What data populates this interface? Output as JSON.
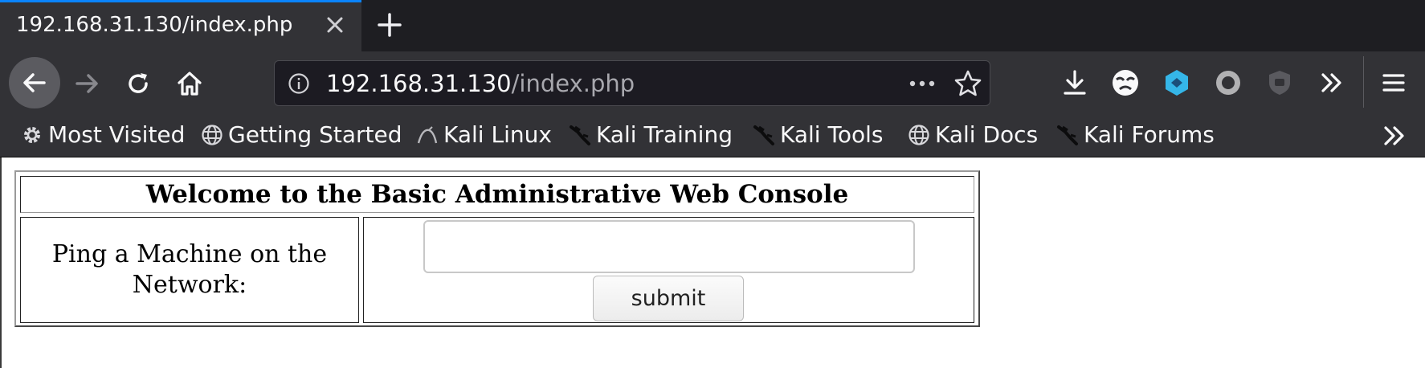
{
  "tab": {
    "title": "192.168.31.130/index.php"
  },
  "urlbar": {
    "host": "192.168.31.130",
    "path": "/index.php"
  },
  "bookmarks": [
    {
      "label": "Most Visited",
      "icon": "gear-icon"
    },
    {
      "label": "Getting Started",
      "icon": "globe-icon"
    },
    {
      "label": "Kali Linux",
      "icon": "kali-dragon-icon"
    },
    {
      "label": "Kali Training",
      "icon": "kali-dragon-icon"
    },
    {
      "label": "Kali Tools",
      "icon": "kali-dragon-icon"
    },
    {
      "label": "Kali Docs",
      "icon": "globe-icon"
    },
    {
      "label": "Kali Forums",
      "icon": "kali-dragon-icon"
    }
  ],
  "page": {
    "header": "Welcome to the Basic Administrative Web Console",
    "ping_label": "Ping a Machine on the Network:",
    "ping_input_value": "",
    "submit_label": "submit"
  },
  "colors": {
    "tab_accent": "#0a84ff",
    "toolbar_bg": "#323236",
    "tabstrip_bg": "#1e1e22",
    "extension_accent": "#35b6e8"
  }
}
